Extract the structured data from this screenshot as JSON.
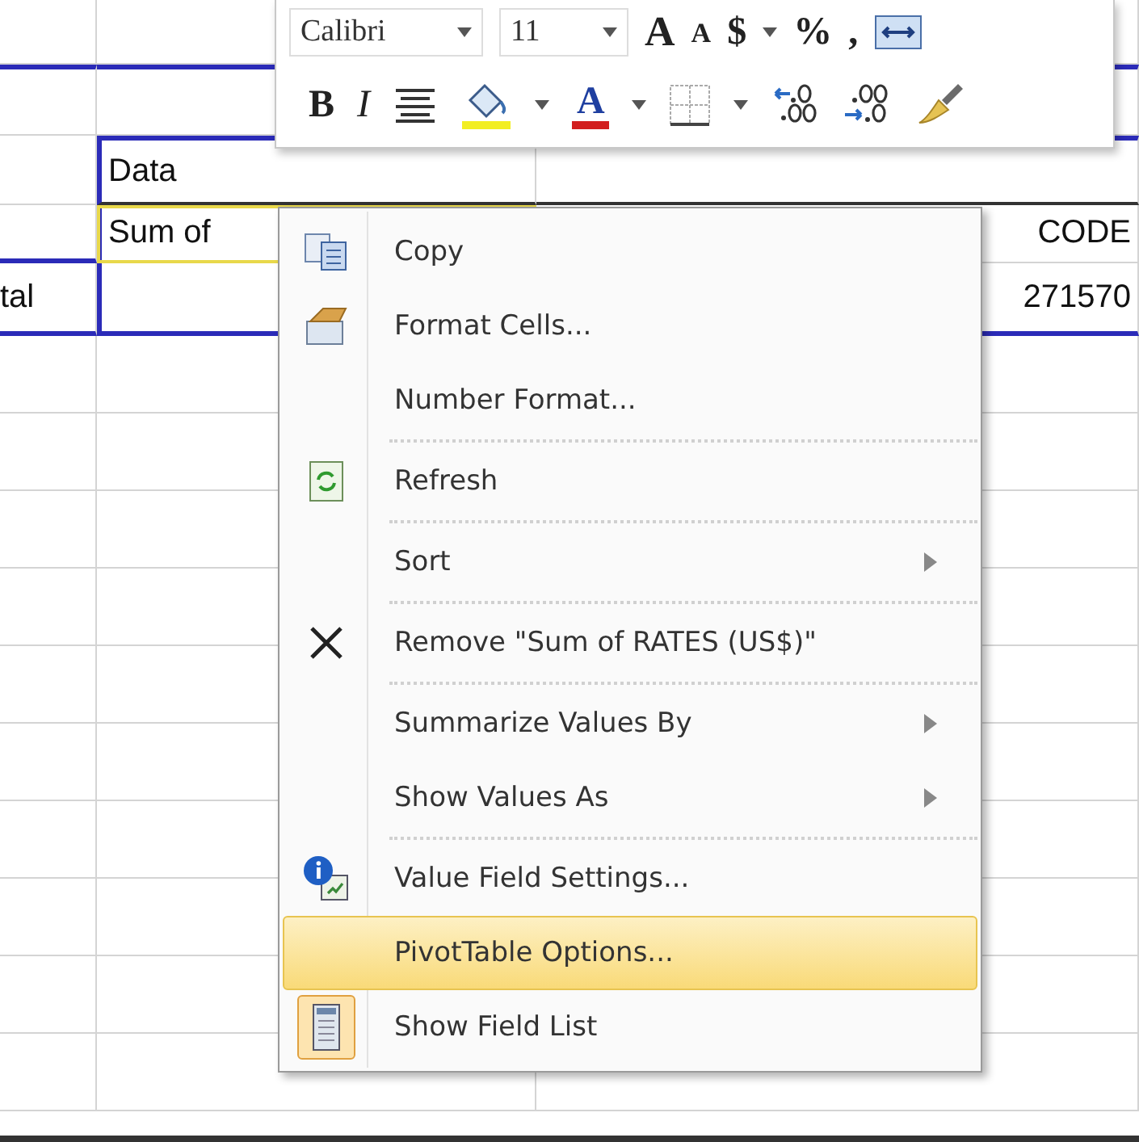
{
  "toolbar": {
    "font": "Calibri",
    "size": "11",
    "row_1": [
      {
        "kind": "grow_font",
        "text": "A"
      },
      {
        "kind": "shrink_font",
        "text": "A"
      },
      {
        "kind": "currency",
        "text": "$"
      },
      {
        "kind": "caret"
      },
      {
        "kind": "percent",
        "text": "%"
      },
      {
        "kind": "comma",
        "text": ","
      },
      {
        "kind": "merge"
      }
    ],
    "row_2": [
      {
        "kind": "bold",
        "text": "B"
      },
      {
        "kind": "italic",
        "text": "I"
      },
      {
        "kind": "align"
      },
      {
        "kind": "fill"
      },
      {
        "kind": "caret"
      },
      {
        "kind": "font_color",
        "text": "A"
      },
      {
        "kind": "caret"
      },
      {
        "kind": "borders"
      },
      {
        "kind": "caret"
      },
      {
        "kind": "increase_decimal"
      },
      {
        "kind": "decrease_decimal"
      },
      {
        "kind": "painter"
      }
    ]
  },
  "sheet": {
    "data_header": "Data",
    "value_field": "Sum of",
    "code_header": "CODE",
    "total_label": "tal",
    "code_total": "271570"
  },
  "menu": [
    {
      "label": "Copy",
      "kind": "copy",
      "submenu": false,
      "selected": false,
      "checked": false,
      "separator_after": false
    },
    {
      "label": "Format Cells...",
      "kind": "format",
      "submenu": false,
      "selected": false,
      "checked": false,
      "separator_after": false
    },
    {
      "label": "Number Format...",
      "kind": "plain",
      "submenu": false,
      "selected": false,
      "checked": false,
      "separator_after": true
    },
    {
      "label": "Refresh",
      "kind": "refresh",
      "submenu": false,
      "selected": false,
      "checked": false,
      "separator_after": true
    },
    {
      "label": "Sort",
      "kind": "plain",
      "submenu": true,
      "selected": false,
      "checked": false,
      "separator_after": true
    },
    {
      "label": "Remove \"Sum of RATES (US$)\"",
      "kind": "remove",
      "submenu": false,
      "selected": false,
      "checked": false,
      "separator_after": true
    },
    {
      "label": "Summarize Values By",
      "kind": "plain",
      "submenu": true,
      "selected": false,
      "checked": false,
      "separator_after": false
    },
    {
      "label": "Show Values As",
      "kind": "plain",
      "submenu": true,
      "selected": false,
      "checked": false,
      "separator_after": true
    },
    {
      "label": "Value Field Settings...",
      "kind": "settings",
      "submenu": false,
      "selected": false,
      "checked": false,
      "separator_after": false
    },
    {
      "label": "PivotTable Options...",
      "kind": "plain",
      "submenu": false,
      "selected": true,
      "checked": false,
      "separator_after": false
    },
    {
      "label": "Show Field List",
      "kind": "field_list",
      "submenu": false,
      "selected": false,
      "checked": true,
      "separator_after": false
    }
  ]
}
